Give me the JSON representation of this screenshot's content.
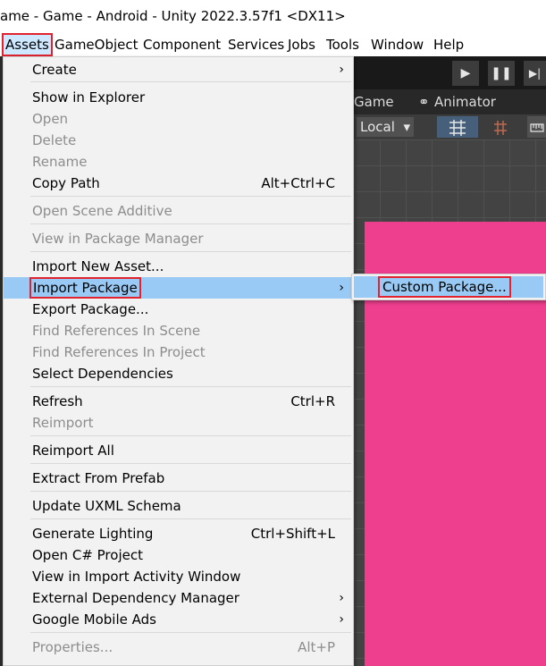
{
  "window": {
    "title": "ame - Game - Android - Unity 2022.3.57f1 <DX11>"
  },
  "menubar": {
    "items": [
      "Assets",
      "GameObject",
      "Component",
      "Services",
      "Jobs",
      "Tools",
      "Window",
      "Help"
    ],
    "active": "Assets"
  },
  "editor": {
    "tabs": [
      "Game",
      "Animator"
    ],
    "pivot_rotation": "Local",
    "play_icon": "play-icon",
    "pause_icon": "pause-icon",
    "step_icon": "step-icon",
    "play_glyph": "▶",
    "pause_glyph": "❚❚",
    "step_glyph": "▶|",
    "animator_glyph": "⚭",
    "dropdown_glyph": "▾"
  },
  "assets_menu": {
    "items": [
      {
        "label": "Create",
        "submenu": true
      },
      {
        "label": "Show in Explorer"
      },
      {
        "label": "Open",
        "disabled": true
      },
      {
        "label": "Delete",
        "disabled": true
      },
      {
        "label": "Rename",
        "disabled": true
      },
      {
        "label": "Copy Path",
        "shortcut": "Alt+Ctrl+C"
      },
      {
        "label": "Open Scene Additive",
        "disabled": true
      },
      {
        "label": "View in Package Manager",
        "disabled": true
      },
      {
        "label": "Import New Asset..."
      },
      {
        "label": "Import Package",
        "submenu": true,
        "highlighted": true
      },
      {
        "label": "Export Package..."
      },
      {
        "label": "Find References In Scene",
        "disabled": true
      },
      {
        "label": "Find References In Project",
        "disabled": true
      },
      {
        "label": "Select Dependencies"
      },
      {
        "label": "Refresh",
        "shortcut": "Ctrl+R"
      },
      {
        "label": "Reimport",
        "disabled": true
      },
      {
        "label": "Reimport All"
      },
      {
        "label": "Extract From Prefab"
      },
      {
        "label": "Update UXML Schema"
      },
      {
        "label": "Generate Lighting",
        "shortcut": "Ctrl+Shift+L"
      },
      {
        "label": "Open C# Project"
      },
      {
        "label": "View in Import Activity Window"
      },
      {
        "label": "External Dependency Manager",
        "submenu": true
      },
      {
        "label": "Google Mobile Ads",
        "submenu": true
      },
      {
        "label": "Properties...",
        "shortcut": "Alt+P",
        "disabled": true
      }
    ],
    "submenu_arrow": "›"
  },
  "import_package_submenu": {
    "items": [
      {
        "label": "Custom Package...",
        "highlighted": true
      }
    ]
  },
  "colors": {
    "menu_bg": "#f2f2f2",
    "highlight": "#99c9f5",
    "annotation_border": "#e0232e",
    "scene_pink": "#ee3f8e",
    "disabled_text": "#8d8d8d"
  }
}
